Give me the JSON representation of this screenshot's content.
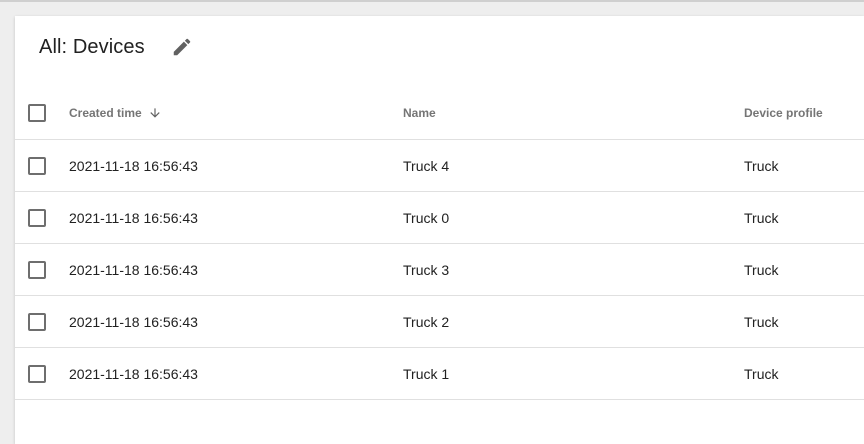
{
  "page": {
    "title": "All: Devices"
  },
  "table": {
    "columns": {
      "created": "Created time",
      "name": "Name",
      "profile": "Device profile"
    },
    "sort": {
      "column": "created",
      "direction": "descending",
      "icon": "arrow-down-icon"
    },
    "rows": [
      {
        "created": "2021-11-18 16:56:43",
        "name": "Truck 4",
        "profile": "Truck"
      },
      {
        "created": "2021-11-18 16:56:43",
        "name": "Truck 0",
        "profile": "Truck"
      },
      {
        "created": "2021-11-18 16:56:43",
        "name": "Truck 3",
        "profile": "Truck"
      },
      {
        "created": "2021-11-18 16:56:43",
        "name": "Truck 2",
        "profile": "Truck"
      },
      {
        "created": "2021-11-18 16:56:43",
        "name": "Truck 1",
        "profile": "Truck"
      }
    ]
  },
  "icons": {
    "edit": "pencil-icon"
  },
  "colors": {
    "text_primary": "#212121",
    "text_secondary": "#757575",
    "divider": "#e0e0e0",
    "icon": "#616161"
  }
}
